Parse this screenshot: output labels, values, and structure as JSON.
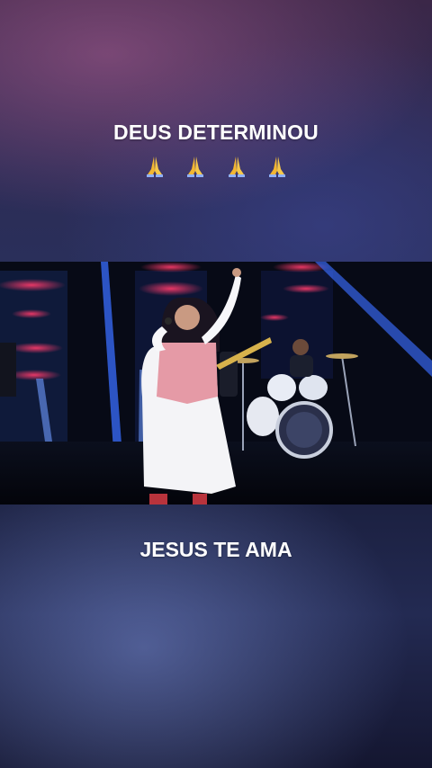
{
  "overlay": {
    "top_caption": "DEUS DETERMINOU",
    "emoji_icons": [
      "folded-hands-icon",
      "folded-hands-icon",
      "folded-hands-icon",
      "folded-hands-icon"
    ],
    "bottom_caption": "JESUS TE AMA"
  },
  "colors": {
    "caption_text": "#ffffff",
    "emoji_fill": "#f4c23d",
    "stage_red": "#ff3b6b",
    "stage_blue": "#3a6dff"
  }
}
